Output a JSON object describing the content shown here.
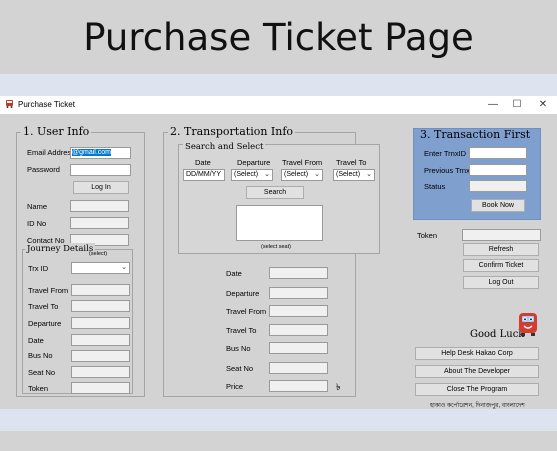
{
  "page_title": "Purchase Ticket Page",
  "window": {
    "title": "Purchase Ticket",
    "minimize": "—",
    "maximize": "☐",
    "close": "✕"
  },
  "user_info": {
    "title": "1. User Info",
    "email_label": "Email Address",
    "email_value": "@gmail.com",
    "password_label": "Password",
    "login_button": "Log In",
    "name_label": "Name",
    "id_label": "ID No",
    "contact_label": "Contact No"
  },
  "journey": {
    "title": "Journey Details",
    "select_hint": "(select)",
    "trx_label": "Trx ID",
    "fields": [
      "Travel From",
      "Travel To",
      "Departure",
      "Date",
      "Bus No",
      "Seat No",
      "Token"
    ]
  },
  "transportation": {
    "title": "2. Transportation Info",
    "search_title": "Search and Select",
    "col_date": "Date",
    "col_departure": "Departure",
    "col_from": "Travel From",
    "col_to": "Travel To",
    "date_placeholder": "DD/MM/YY",
    "select_text": "(Select)",
    "search_button": "Search",
    "seat_hint": "(select seat)",
    "fields": [
      "Date",
      "Departure",
      "Travel From",
      "Travel To",
      "Bus No",
      "Seat No",
      "Price"
    ],
    "currency": "৳"
  },
  "transaction": {
    "title": "3. Transaction First",
    "trx_label": "Enter TrnxID",
    "prev_label": "Previous TrnxID",
    "status_label": "Status",
    "book_button": "Book Now"
  },
  "right": {
    "token_label": "Token",
    "refresh": "Refresh",
    "confirm": "Confirm Ticket",
    "logout": "Log Out",
    "good_luck": "Good Luck",
    "helpdesk": "Help Desk Hakao Corp",
    "about": "About The Developer",
    "close": "Close The Program",
    "footer": "হাকাও কর্পোরেশন, দিনাজপুর, বাংলাদেশ"
  },
  "colors": {
    "transaction_panel": "#7f9fcf",
    "background": "#d3d3d3",
    "strip": "#dde3ef"
  }
}
